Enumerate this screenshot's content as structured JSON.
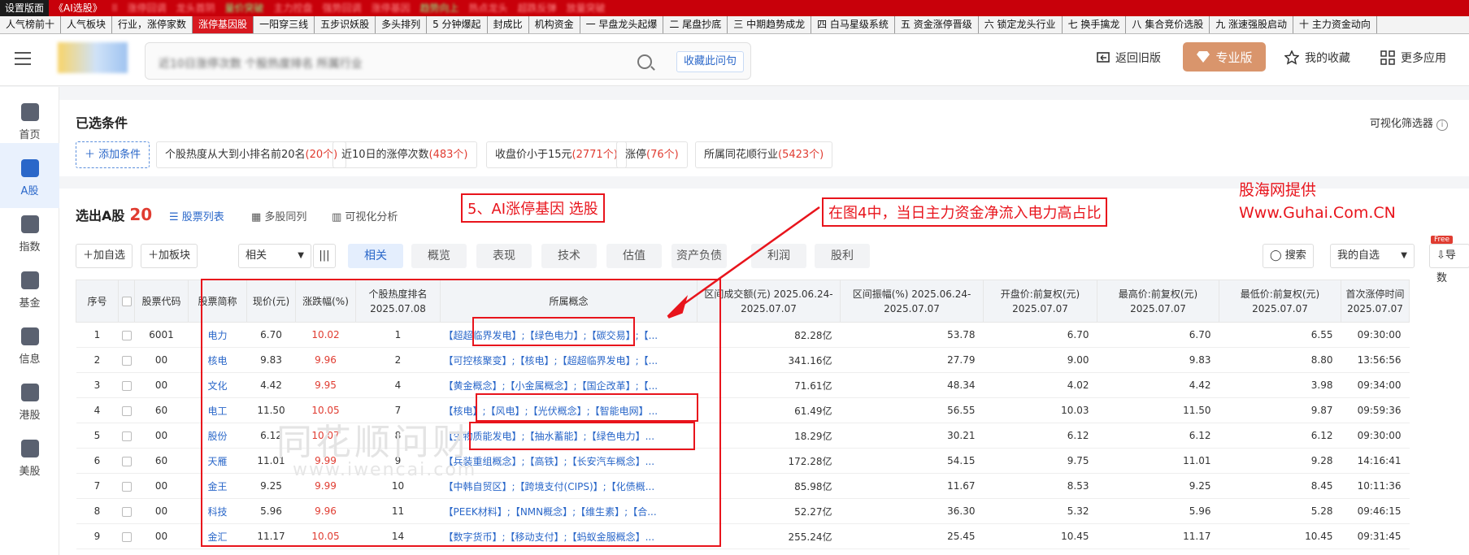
{
  "top_nav": [
    {
      "label": "设置版面",
      "style": "dark"
    },
    {
      "label": "《AI选股》",
      "style": "plain"
    },
    {
      "label": "ll",
      "style": "blur"
    },
    {
      "label": "涨停回调",
      "style": "blur"
    },
    {
      "label": "龙头首阴",
      "style": "blur"
    },
    {
      "label": "量价突破",
      "style": "green"
    },
    {
      "label": "主力控盘",
      "style": "blur"
    },
    {
      "label": "强势回调",
      "style": "blur"
    },
    {
      "label": "涨停基因",
      "style": "blur"
    },
    {
      "label": "趋势向上",
      "style": "green"
    },
    {
      "label": "热点龙头",
      "style": "blur"
    },
    {
      "label": "超跌反弹",
      "style": "blur"
    },
    {
      "label": "放量突破",
      "style": "blur"
    }
  ],
  "strategy_tabs": [
    "人气榜前十",
    "人气板块",
    "行业，涨停家数",
    "涨停基因股",
    "一阳穿三线",
    "五步识妖股",
    "多头排列",
    "5 分钟爆起",
    "封成比",
    "机构资金",
    "一 早盘龙头起爆",
    "二 尾盘抄底",
    "三 中期趋势成龙",
    "四 白马星级系统",
    "五 资金涨停晋级",
    "六 锁定龙头行业",
    "七 换手擒龙",
    "八 集合竞价选股",
    "九 涨速强股启动",
    "十 主力资金动向"
  ],
  "strategy_tab_active": "涨停基因股",
  "header": {
    "search_text": "近10日涨停次数 个股热度排名 所属行业",
    "collect_question": "收藏此问句",
    "back_old": "返回旧版",
    "pro": "专业版",
    "my_favorites": "我的收藏",
    "more_apps": "更多应用"
  },
  "sidebar": [
    "首页",
    "A股",
    "指数",
    "基金",
    "信息",
    "港股",
    "美股"
  ],
  "sidebar_active": "A股",
  "conditions": {
    "title": "已选条件",
    "visual_filter": "可视化筛选器",
    "add": "添加条件",
    "chips": [
      {
        "text": "个股热度从大到小排名前20名",
        "count": "(20个)"
      },
      {
        "text": "近10日的涨停次数",
        "count": "(483个)"
      },
      {
        "text": "收盘价小于15元",
        "count": "(2771个)"
      },
      {
        "text": "涨停",
        "count": "(76个)"
      },
      {
        "text": "所属同花顺行业",
        "count": "(5423个)"
      }
    ]
  },
  "results": {
    "title": "选出A股",
    "count": "20",
    "view_tabs": [
      "股票列表",
      "多股同列",
      "可视化分析"
    ],
    "add_watch": "加自选",
    "add_block": "加板块",
    "sort_label": "相关",
    "filter_tabs": [
      "相关",
      "概览",
      "表现",
      "技术",
      "估值",
      "资产负债",
      "利润",
      "股利"
    ],
    "search_btn": "搜索",
    "my_watch": "我的自选",
    "export": "导数",
    "free_badge": "Free"
  },
  "table": {
    "headers": [
      "序号",
      "",
      "股票代码",
      "股票简称",
      "现价(元)",
      "涨跌幅(%)",
      "个股热度排名 2025.07.08",
      "所属概念",
      "区间成交额(元) 2025.06.24-2025.07.07",
      "区间振幅(%) 2025.06.24-2025.07.07",
      "开盘价:前复权(元) 2025.07.07",
      "最高价:前复权(元) 2025.07.07",
      "最低价:前复权(元) 2025.07.07",
      "首次涨停时间 2025.07.07"
    ],
    "rows": [
      {
        "no": "1",
        "code": "6001",
        "name": "电力",
        "price": "6.70",
        "chg": "10.02",
        "rank": "1",
        "concept": "【超超临界发电】;【绿色电力】;【碳交易】;【...",
        "amount": "82.28亿",
        "amp": "53.78",
        "open": "6.70",
        "high": "6.70",
        "low": "6.55",
        "time": "09:30:00"
      },
      {
        "no": "2",
        "code": "00",
        "name": "核电",
        "price": "9.83",
        "chg": "9.96",
        "rank": "2",
        "concept": "【可控核聚变】;【核电】;【超超临界发电】;【...",
        "amount": "341.16亿",
        "amp": "27.79",
        "open": "9.00",
        "high": "9.83",
        "low": "8.80",
        "time": "13:56:56"
      },
      {
        "no": "3",
        "code": "00",
        "name": "文化",
        "price": "4.42",
        "chg": "9.95",
        "rank": "4",
        "concept": "【黄金概念】;【小金属概念】;【国企改革】;【...",
        "amount": "71.61亿",
        "amp": "48.34",
        "open": "4.02",
        "high": "4.42",
        "low": "3.98",
        "time": "09:34:00"
      },
      {
        "no": "4",
        "code": "60",
        "name": "电工",
        "price": "11.50",
        "chg": "10.05",
        "rank": "7",
        "concept": "【核电】;【风电】;【光伏概念】;【智能电网】...",
        "amount": "61.49亿",
        "amp": "56.55",
        "open": "10.03",
        "high": "11.50",
        "low": "9.87",
        "time": "09:59:36"
      },
      {
        "no": "5",
        "code": "00",
        "name": "股份",
        "price": "6.12",
        "chg": "10.07",
        "rank": "8",
        "concept": "【生物质能发电】;【抽水蓄能】;【绿色电力】...",
        "amount": "18.29亿",
        "amp": "30.21",
        "open": "6.12",
        "high": "6.12",
        "low": "6.12",
        "time": "09:30:00"
      },
      {
        "no": "6",
        "code": "60",
        "name": "天雁",
        "price": "11.01",
        "chg": "9.99",
        "rank": "9",
        "concept": "【兵装重组概念】;【高铁】;【长安汽车概念】...",
        "amount": "172.28亿",
        "amp": "54.15",
        "open": "9.75",
        "high": "11.01",
        "low": "9.28",
        "time": "14:16:41"
      },
      {
        "no": "7",
        "code": "00",
        "name": "金王",
        "price": "9.25",
        "chg": "9.99",
        "rank": "10",
        "concept": "【中韩自贸区】;【跨境支付(CIPS)】;【化债概...",
        "amount": "85.98亿",
        "amp": "11.67",
        "open": "8.53",
        "high": "9.25",
        "low": "8.45",
        "time": "10:11:36"
      },
      {
        "no": "8",
        "code": "00",
        "name": "科技",
        "price": "5.96",
        "chg": "9.96",
        "rank": "11",
        "concept": "【PEEK材料】;【NMN概念】;【维生素】;【合...",
        "amount": "52.27亿",
        "amp": "36.30",
        "open": "5.32",
        "high": "5.96",
        "low": "5.28",
        "time": "09:46:15"
      },
      {
        "no": "9",
        "code": "00",
        "name": "金汇",
        "price": "11.17",
        "chg": "10.05",
        "rank": "14",
        "concept": "【数字货币】;【移动支付】;【蚂蚁金服概念】...",
        "amount": "255.24亿",
        "amp": "25.45",
        "open": "10.45",
        "high": "11.17",
        "low": "10.45",
        "time": "09:31:45"
      }
    ]
  },
  "annotations": {
    "label1": "5、AI涨停基因 选股",
    "label2": "在图4中，当日主力资金净流入电力高占比",
    "source_line1": "股海网提供",
    "source_line2": "Www.Guhai.Com.CN",
    "watermark": "同花顺问财",
    "watermark_url": "www.iwencai.com"
  }
}
